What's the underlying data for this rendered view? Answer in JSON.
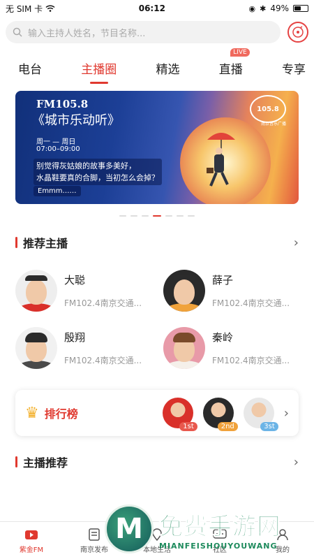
{
  "status_bar": {
    "carrier": "无 SIM 卡",
    "time": "06:12",
    "battery": "49%"
  },
  "search": {
    "placeholder": "输入主持人姓名，节目名称..."
  },
  "tabs": [
    {
      "label": "电台"
    },
    {
      "label": "主播圈"
    },
    {
      "label": "精选"
    },
    {
      "label": "直播",
      "badge": "LIVE"
    },
    {
      "label": "专享"
    }
  ],
  "banner": {
    "frequency": "FM105.8",
    "program": "《城市乐动听》",
    "schedule_days": "周一 — 周日",
    "schedule_time": "07:00–09:00",
    "quote_line1": "别觉得灰姑娘的故事多美好，",
    "quote_line2": "水晶鞋要真的合脚，当初怎么会掉？",
    "tag": "Emmm……",
    "logo": "105.8",
    "logo_caption": "南京音乐广播",
    "dot_count": 7,
    "active_dot": 3
  },
  "recommended_hosts": {
    "title": "推荐主播",
    "hosts": [
      {
        "name": "大聪",
        "station": "FM102.4南京交通..."
      },
      {
        "name": "薛子",
        "station": "FM102.4南京交通..."
      },
      {
        "name": "殷翔",
        "station": "FM102.4南京交通..."
      },
      {
        "name": "秦岭",
        "station": "FM102.4南京交通..."
      }
    ]
  },
  "ranking": {
    "title": "排行榜",
    "ranks": [
      {
        "label": "1st",
        "color": "#e8584d"
      },
      {
        "label": "2nd",
        "color": "#f0a23b"
      },
      {
        "label": "3st",
        "color": "#6cb4e6"
      }
    ]
  },
  "host_recommend": {
    "title": "主播推荐"
  },
  "bottom_nav": [
    {
      "label": "紫金FM",
      "icon": "tv-icon"
    },
    {
      "label": "南京发布",
      "icon": "news-icon"
    },
    {
      "label": "本地生活",
      "icon": "location-icon"
    },
    {
      "label": "社区",
      "icon": "chat-icon"
    },
    {
      "label": "我的",
      "icon": "user-icon"
    }
  ],
  "watermark": {
    "big": "免费手游网",
    "small": "MIANFEISHOUYOUWANG"
  },
  "colors": {
    "accent": "#e0392f"
  }
}
